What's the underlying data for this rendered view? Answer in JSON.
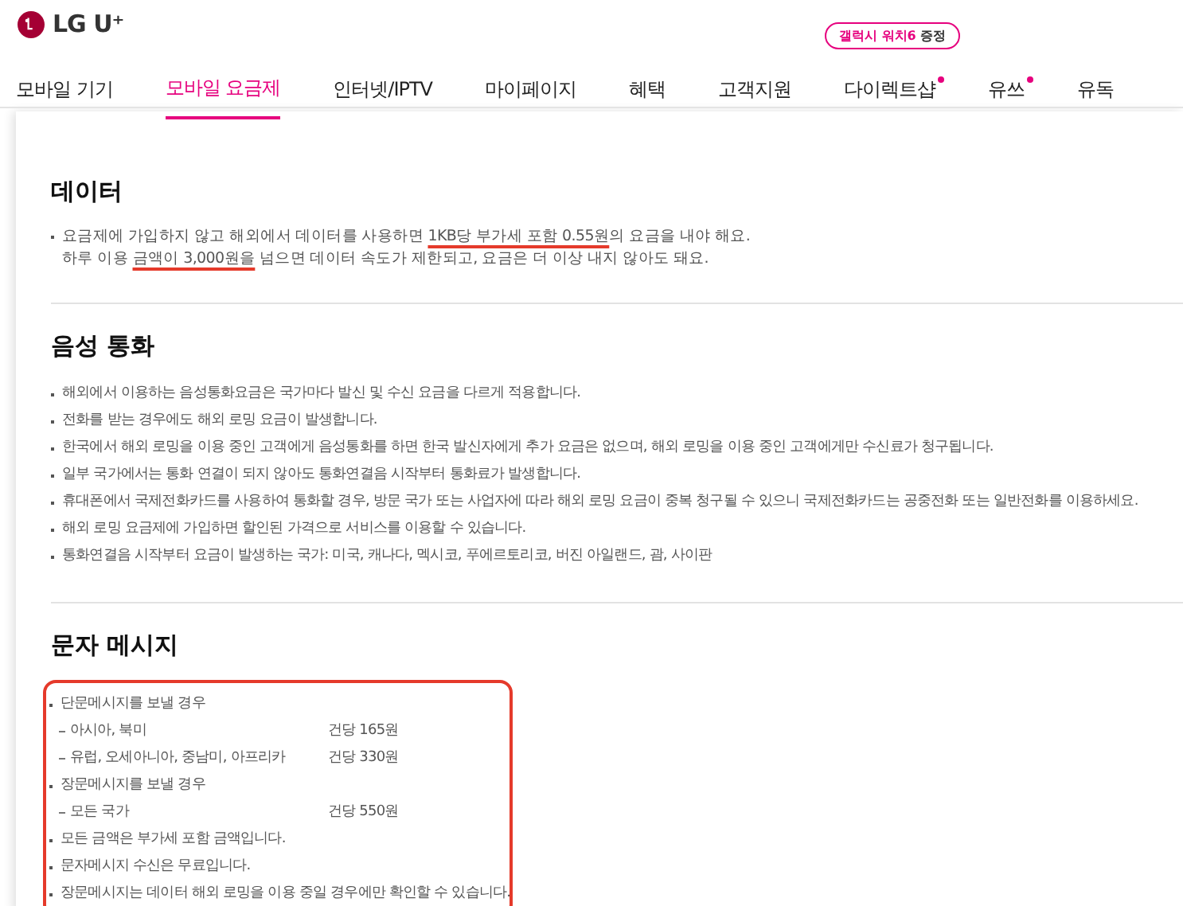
{
  "header": {
    "logo": "LG U⁺"
  },
  "nav": [
    {
      "label": "모바일 기기",
      "selected": false,
      "dot": false
    },
    {
      "label": "모바일 요금제",
      "selected": true,
      "dot": false
    },
    {
      "label": "인터넷/IPTV",
      "selected": false,
      "dot": false
    },
    {
      "label": "마이페이지",
      "selected": false,
      "dot": false
    },
    {
      "label": "혜택",
      "selected": false,
      "dot": false
    },
    {
      "label": "고객지원",
      "selected": false,
      "dot": false
    },
    {
      "label": "다이렉트샵",
      "selected": false,
      "dot": true,
      "badge": {
        "highlight": "갤럭시 워치6",
        "text": "증정"
      }
    },
    {
      "label": "유쓰",
      "selected": false,
      "dot": true
    },
    {
      "label": "유독",
      "selected": false,
      "dot": false
    }
  ],
  "sections": [
    {
      "title": "데이터",
      "kind": "text",
      "paragraphs": [
        [
          {
            "text": "요금제에 가입하지 않고 해외에서 데이터를 사용하면 ",
            "underlined": false
          },
          {
            "text": "1KB당 부가세 포함 0.55원",
            "underlined": true
          },
          {
            "text": "의 요금을 내야 해요.",
            "underlined": false
          }
        ],
        [
          {
            "text": "하루 이용 ",
            "underlined": false
          },
          {
            "text": "금액이 3,000원을",
            "underlined": true
          },
          {
            "text": " 넘으면 데이터 속도가 제한되고, 요금은 더 이상 내지 않아도 돼요.",
            "underlined": false
          }
        ]
      ]
    },
    {
      "title": "음성 통화",
      "kind": "list",
      "items": [
        "해외에서 이용하는 음성통화요금은 국가마다 발신 및 수신 요금을 다르게 적용합니다.",
        "전화를 받는 경우에도 해외 로밍 요금이 발생합니다.",
        "한국에서 해외 로밍을 이용 중인 고객에게 음성통화를 하면 한국 발신자에게 추가 요금은 없으며, 해외 로밍을 이용 중인 고객에게만 수신료가 청구됩니다.",
        "일부 국가에서는 통화 연결이 되지 않아도 통화연결음 시작부터 통화료가 발생합니다.",
        "휴대폰에서 국제전화카드를 사용하여 통화할 경우, 방문 국가 또는 사업자에 따라 해외 로밍 요금이 중복 청구될 수 있으니 국제전화카드는 공중전화 또는 일반전화를 이용하세요.",
        "해외 로밍 요금제에 가입하면 할인된 가격으로 서비스를 이용할 수 있습니다.",
        "통화연결음 시작부터 요금이 발생하는 국가: 미국, 캐나다, 멕시코, 푸에르토리코, 버진 아일랜드, 괌, 사이판"
      ]
    },
    {
      "title": "문자 메시지",
      "kind": "boxed",
      "rows": [
        {
          "kind": "bullet",
          "text": "단문메시지를 보낼 경우"
        },
        {
          "kind": "sub",
          "text": "아시아, 북미",
          "price": "건당 165원"
        },
        {
          "kind": "sub",
          "text": "유럽, 오세아니아, 중남미, 아프리카",
          "price": "건당 330원"
        },
        {
          "kind": "bullet",
          "text": "장문메시지를 보낼 경우"
        },
        {
          "kind": "sub",
          "text": "모든 국가",
          "price": "건당 550원"
        },
        {
          "kind": "bullet",
          "text": "모든 금액은 부가세 포함 금액입니다."
        },
        {
          "kind": "bullet",
          "text": "문자메시지 수신은 무료입니다."
        },
        {
          "kind": "bullet",
          "text": "장문메시지는 데이터 해외 로밍을 이용 중일 경우에만 확인할 수 있습니다."
        }
      ]
    }
  ]
}
